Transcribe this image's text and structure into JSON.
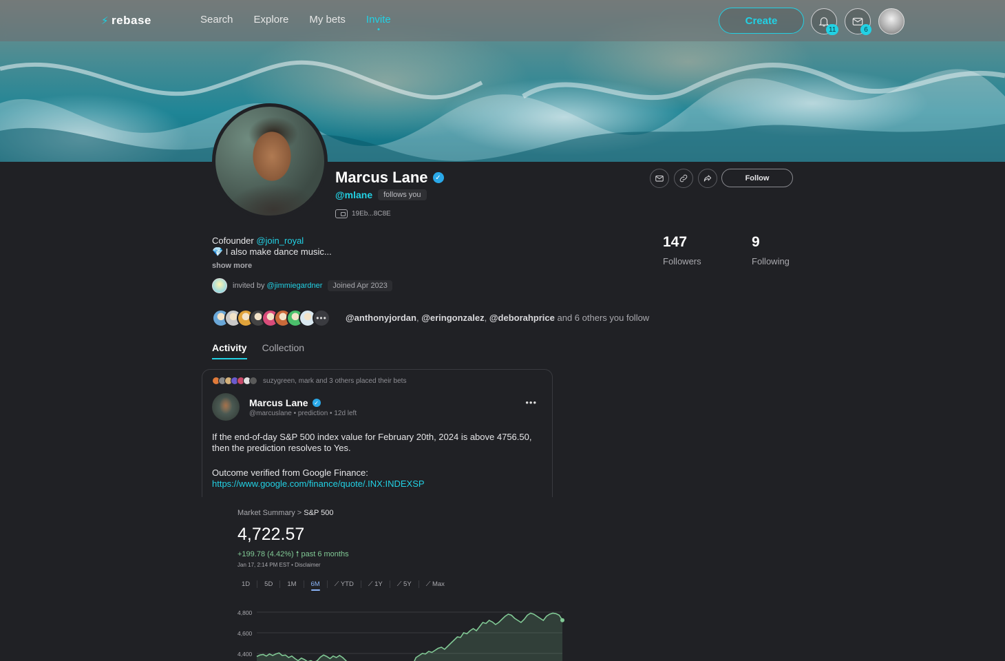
{
  "nav": {
    "logo": "rebase",
    "links": [
      "Search",
      "Explore",
      "My bets",
      "Invite"
    ],
    "active_link": "Invite",
    "create_label": "Create",
    "notifications_count": "11",
    "messages_count": "6"
  },
  "profile": {
    "name": "Marcus Lane",
    "handle": "@mlane",
    "follows_you": "follows you",
    "wallet": "19Eb...8C8E",
    "follow_label": "Follow",
    "bio_prefix": "Cofounder",
    "bio_mention": "@join_royal",
    "bio_line2": "💎 I also make dance music...",
    "show_more": "show more",
    "invited_by_prefix": "invited by",
    "invited_by": "@jimmiegardner",
    "joined": "Joined Apr 2023",
    "followers_count": "147",
    "followers_label": "Followers",
    "following_count": "9",
    "following_label": "Following",
    "mutual_1": "@anthonyjordan",
    "mutual_2": "@eringonzalez",
    "mutual_3": "@deborahprice",
    "mutual_suffix": "and 6 others you follow",
    "mutual_avatar_colors": [
      "#6aa7d8",
      "#c9c9c9",
      "#e0a33b",
      "#444",
      "#d94c7a",
      "#c96a3a",
      "#4bbf6b",
      "#d9e8f0"
    ]
  },
  "tabs": [
    "Activity",
    "Collection"
  ],
  "post": {
    "meta": "suzygreen, mark  and  3 others placed their bets",
    "author": "Marcus Lane",
    "sub": "@marcuslane • prediction • 12d left",
    "body": "If the end-of-day S&P 500 index value for February 20th, 2024 is above 4756.50, then the prediction resolves to Yes.",
    "verify_line": "Outcome verified from Google Finance:",
    "link": "https://www.google.com/finance/quote/.INX:INDEXSP",
    "tiny_avatar_colors": [
      "#e07a3a",
      "#8a8a8a",
      "#d3b07a",
      "#6a5acd",
      "#c94a6a",
      "#e0e0e0",
      "#5a5a5a"
    ]
  },
  "finance": {
    "breadcrumb_prefix": "Market Summary >",
    "breadcrumb_name": "S&P 500",
    "price": "4,722.57",
    "change": "+199.78 (4.42%) 🠕 past 6 months",
    "date": "Jan 17, 2:14 PM EST • Disclaimer",
    "ranges": [
      "1D",
      "5D",
      "1M",
      "6M",
      "YTD",
      "1Y",
      "5Y",
      "Max"
    ],
    "active_range": "6M",
    "line_color": "#81c995"
  },
  "chart_data": {
    "type": "area",
    "title": "",
    "ylabel": "",
    "y_ticks": [
      "4,800",
      "4,600",
      "4,400"
    ],
    "ylim": [
      4300,
      4850
    ],
    "values": [
      4370,
      4385,
      4390,
      4375,
      4395,
      4380,
      4395,
      4405,
      4380,
      4385,
      4360,
      4375,
      4350,
      4330,
      4355,
      4340,
      4320,
      4330,
      4315,
      4330,
      4365,
      4385,
      4370,
      4350,
      4375,
      4360,
      4380,
      4360,
      4330,
      4300,
      4290,
      4250,
      4220,
      4200,
      4190,
      4230,
      4260,
      4240,
      4220,
      4230,
      4210,
      4235,
      4260,
      4240,
      4230,
      4220,
      4200,
      4190,
      4240,
      4290,
      4360,
      4380,
      4400,
      4395,
      4420,
      4410,
      4430,
      4450,
      4460,
      4440,
      4470,
      4500,
      4530,
      4560,
      4555,
      4600,
      4590,
      4620,
      4640,
      4620,
      4660,
      4700,
      4690,
      4720,
      4705,
      4680,
      4700,
      4730,
      4760,
      4780,
      4770,
      4740,
      4720,
      4700,
      4730,
      4770,
      4790,
      4780,
      4760,
      4740,
      4720,
      4760,
      4780,
      4790,
      4785,
      4770,
      4722
    ]
  }
}
